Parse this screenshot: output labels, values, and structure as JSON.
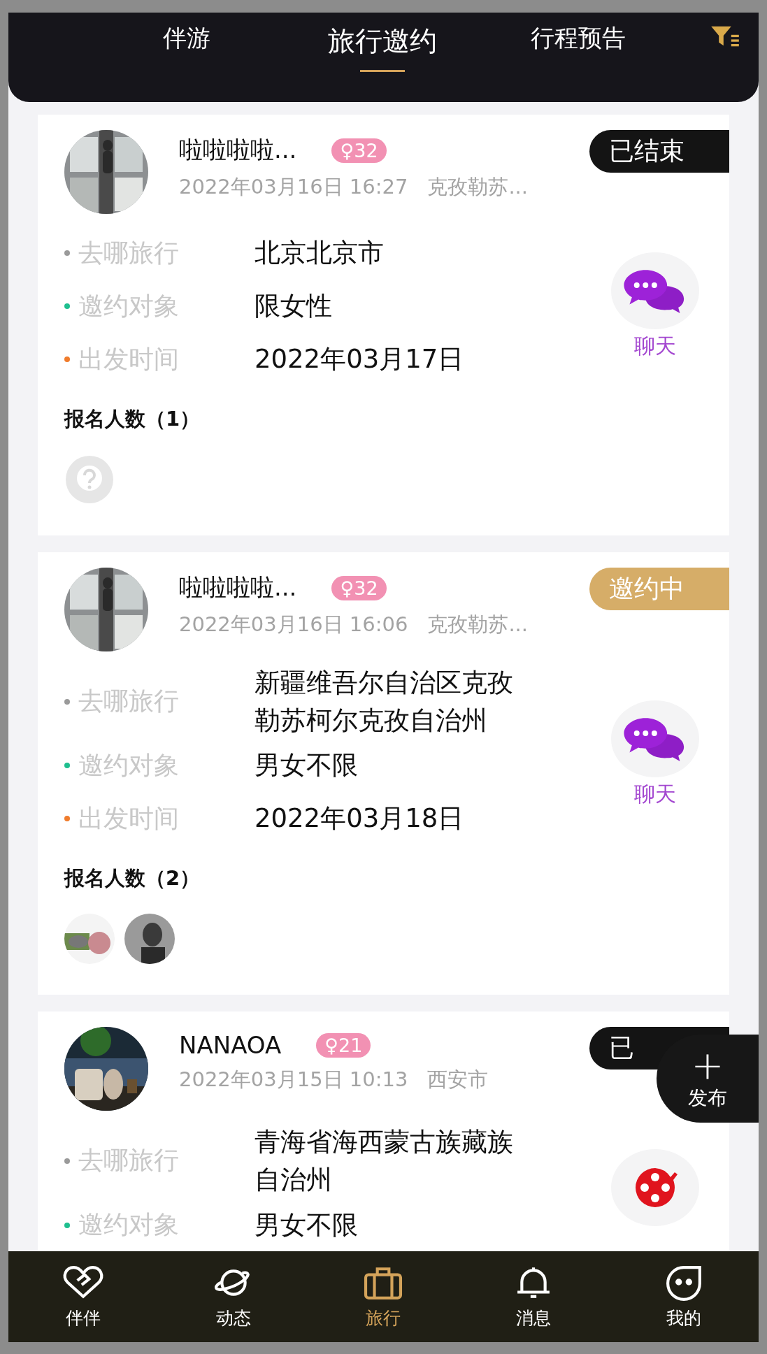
{
  "top_tabs": [
    {
      "label": "伴游",
      "selected": false
    },
    {
      "label": "旅行邀约",
      "selected": true
    },
    {
      "label": "行程预告",
      "selected": false
    }
  ],
  "posts": [
    {
      "name": "啦啦啦啦...",
      "gender": "♀",
      "age": "32",
      "datetime": "2022年03月16日 16:27",
      "location": "克孜勒苏...",
      "status": {
        "kind": "ended",
        "label": "已结束"
      },
      "details": [
        {
          "label": "去哪旅行",
          "value": "北京北京市",
          "color": "#9a9a9a"
        },
        {
          "label": "邀约对象",
          "value": "限女性",
          "color": "#1fbf8f"
        },
        {
          "label": "出发时间",
          "value": "2022年03月17日",
          "color": "#f07c2c"
        }
      ],
      "action": {
        "kind": "chat",
        "label": "聊天"
      },
      "signup_label": "报名人数（1）",
      "attendees": [
        {
          "kind": "placeholder"
        }
      ]
    },
    {
      "name": "啦啦啦啦...",
      "gender": "♀",
      "age": "32",
      "datetime": "2022年03月16日 16:06",
      "location": "克孜勒苏...",
      "status": {
        "kind": "inviting",
        "label": "邀约中"
      },
      "details": [
        {
          "label": "去哪旅行",
          "value": "新疆维吾尔自治区克孜勒苏柯尔克孜自治州",
          "color": "#9a9a9a"
        },
        {
          "label": "邀约对象",
          "value": "男女不限",
          "color": "#1fbf8f"
        },
        {
          "label": "出发时间",
          "value": "2022年03月18日",
          "color": "#f07c2c"
        }
      ],
      "action": {
        "kind": "chat",
        "label": "聊天"
      },
      "signup_label": "报名人数（2）"
    },
    {
      "name": "NANAOA",
      "gender": "♀",
      "age": "21",
      "datetime": "2022年03月15日 10:13",
      "location": "西安市",
      "status": {
        "kind": "ended",
        "label": "已"
      },
      "details": [
        {
          "label": "去哪旅行",
          "value": "青海省海西蒙古族藏族自治州",
          "color": "#9a9a9a"
        },
        {
          "label": "邀约对象",
          "value": "男女不限",
          "color": "#1fbf8f"
        }
      ],
      "action": {
        "kind": "film"
      }
    }
  ],
  "publish_button": {
    "label": "发布",
    "symbol": "+"
  },
  "bottom_nav": [
    {
      "label": "伴伴",
      "kind": "heart",
      "selected": false
    },
    {
      "label": "动态",
      "kind": "planet",
      "selected": false
    },
    {
      "label": "旅行",
      "kind": "briefcase",
      "selected": true
    },
    {
      "label": "消息",
      "kind": "bell",
      "selected": false
    },
    {
      "label": "我的",
      "kind": "face",
      "selected": false
    }
  ]
}
